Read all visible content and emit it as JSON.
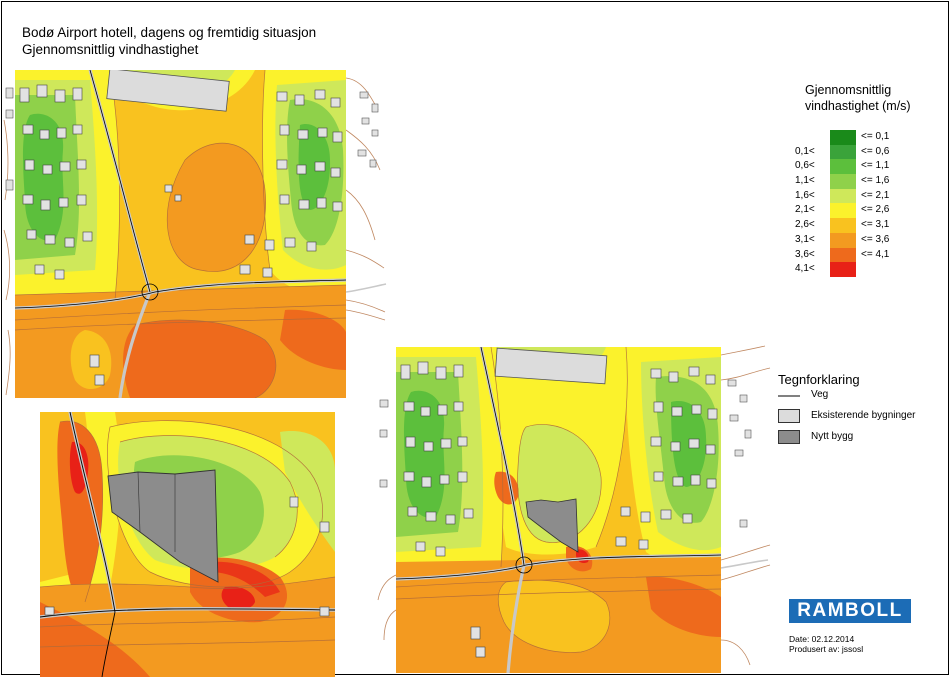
{
  "title": {
    "line1": "Bodø Airport hotell, dagens og fremtidig situasjon",
    "line2": "Gjennomsnittlig vindhastighet"
  },
  "scale": {
    "title_line1": "Gjennomsnittlig",
    "title_line2": "vindhastighet (m/s)",
    "classes": [
      {
        "left": "",
        "right": "<= 0,1",
        "color": "#1a8a1a"
      },
      {
        "left": "0,1<",
        "right": "<= 0,6",
        "color": "#3aa33a"
      },
      {
        "left": "0,6<",
        "right": "<= 1,1",
        "color": "#5cbf3c"
      },
      {
        "left": "1,1<",
        "right": "<= 1,6",
        "color": "#8fd14a"
      },
      {
        "left": "1,6<",
        "right": "<= 2,1",
        "color": "#cfe85a"
      },
      {
        "left": "2,1<",
        "right": "<= 2,6",
        "color": "#fbf22c"
      },
      {
        "left": "2,6<",
        "right": "<= 3,1",
        "color": "#f9c21f"
      },
      {
        "left": "3,1<",
        "right": "<= 3,6",
        "color": "#f39a20"
      },
      {
        "left": "3,6<",
        "right": "<= 4,1",
        "color": "#ee6a1c"
      },
      {
        "left": "4,1<",
        "right": "",
        "color": "#e82117"
      }
    ]
  },
  "tegnforklaring": {
    "title": "Tegnforklaring",
    "items": [
      {
        "label": "Veg",
        "symbol": "line",
        "color": "#000000"
      },
      {
        "label": "Eksisterende bygninger",
        "symbol": "box",
        "color": "#dcdcdc"
      },
      {
        "label": "Nytt bygg",
        "symbol": "box",
        "color": "#8c8c8c"
      }
    ]
  },
  "logo": {
    "text": "RAMBOLL",
    "color": "#1c6cb6"
  },
  "meta": {
    "date": "Date: 02.12.2014",
    "produced": "Produsert av: jssosl"
  }
}
